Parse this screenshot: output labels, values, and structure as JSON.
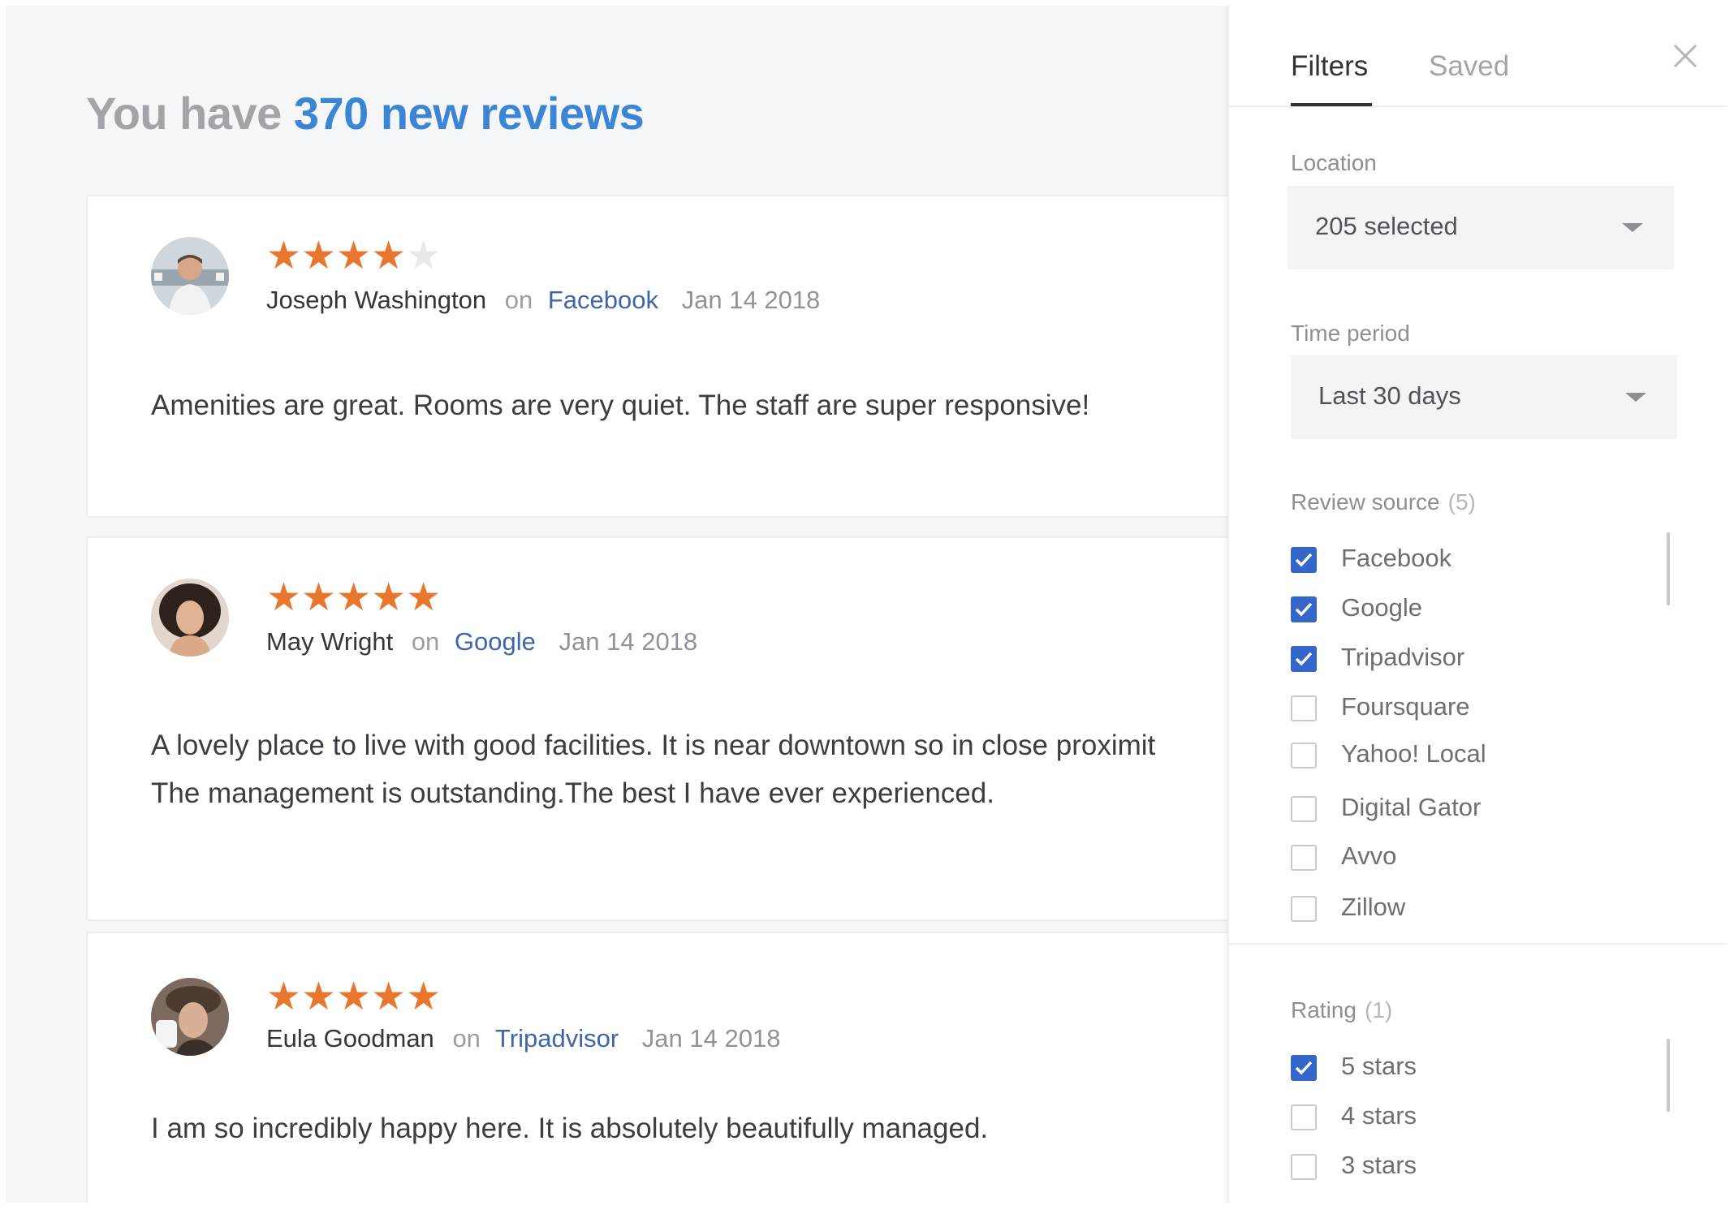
{
  "header": {
    "prefix": "You have",
    "highlight": "370 new reviews"
  },
  "reviews": [
    {
      "rating": 4,
      "author": "Joseph Washington",
      "on": "on",
      "source": "Facebook",
      "date": "Jan 14 2018",
      "lines": [
        "Amenities are great.  Rooms are very quiet.  The staff are super responsive!"
      ]
    },
    {
      "rating": 5,
      "author": "May Wright",
      "on": "on",
      "source": "Google",
      "date": "Jan 14 2018",
      "lines": [
        "A lovely place to live with good facilities. It is near downtown so in close proximit",
        "The management is outstanding.The best I have ever experienced."
      ]
    },
    {
      "rating": 5,
      "author": "Eula Goodman",
      "on": "on",
      "source": "Tripadvisor",
      "date": "Jan 14 2018",
      "lines": [
        "I am so incredibly happy here. It is absolutely beautifully managed."
      ]
    }
  ],
  "panel": {
    "tabs": [
      {
        "label": "Filters",
        "active": true
      },
      {
        "label": "Saved",
        "active": false
      }
    ],
    "location": {
      "label": "Location",
      "value": "205 selected"
    },
    "time_period": {
      "label": "Time period",
      "value": "Last 30 days"
    },
    "review_source": {
      "label": "Review source",
      "count": "(5)",
      "options": [
        {
          "label": "Facebook",
          "checked": true
        },
        {
          "label": "Google",
          "checked": true
        },
        {
          "label": "Tripadvisor",
          "checked": true
        },
        {
          "label": "Foursquare",
          "checked": false
        },
        {
          "label": "Yahoo! Local",
          "checked": false
        },
        {
          "label": "Digital Gator",
          "checked": false
        },
        {
          "label": "Avvo",
          "checked": false
        },
        {
          "label": "Zillow",
          "checked": false
        }
      ]
    },
    "rating": {
      "label": "Rating",
      "count": "(1)",
      "options": [
        {
          "label": "5 stars",
          "checked": true
        },
        {
          "label": "4 stars",
          "checked": false
        },
        {
          "label": "3 stars",
          "checked": false
        }
      ]
    }
  },
  "colors": {
    "accent": "#3c85d6",
    "star": "#e8772d",
    "checkbox": "#3467c9",
    "link": "#3f66ad"
  }
}
